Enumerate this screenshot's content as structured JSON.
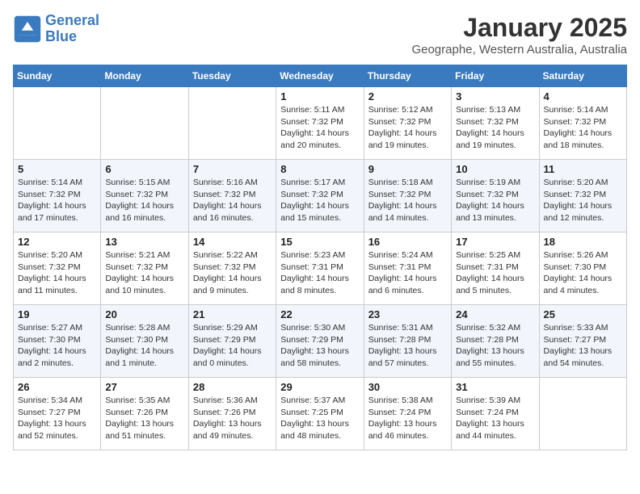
{
  "logo": {
    "line1": "General",
    "line2": "Blue"
  },
  "title": "January 2025",
  "subtitle": "Geographe, Western Australia, Australia",
  "days_of_week": [
    "Sunday",
    "Monday",
    "Tuesday",
    "Wednesday",
    "Thursday",
    "Friday",
    "Saturday"
  ],
  "weeks": [
    [
      {
        "num": "",
        "info": ""
      },
      {
        "num": "",
        "info": ""
      },
      {
        "num": "",
        "info": ""
      },
      {
        "num": "1",
        "info": "Sunrise: 5:11 AM\nSunset: 7:32 PM\nDaylight: 14 hours\nand 20 minutes."
      },
      {
        "num": "2",
        "info": "Sunrise: 5:12 AM\nSunset: 7:32 PM\nDaylight: 14 hours\nand 19 minutes."
      },
      {
        "num": "3",
        "info": "Sunrise: 5:13 AM\nSunset: 7:32 PM\nDaylight: 14 hours\nand 19 minutes."
      },
      {
        "num": "4",
        "info": "Sunrise: 5:14 AM\nSunset: 7:32 PM\nDaylight: 14 hours\nand 18 minutes."
      }
    ],
    [
      {
        "num": "5",
        "info": "Sunrise: 5:14 AM\nSunset: 7:32 PM\nDaylight: 14 hours\nand 17 minutes."
      },
      {
        "num": "6",
        "info": "Sunrise: 5:15 AM\nSunset: 7:32 PM\nDaylight: 14 hours\nand 16 minutes."
      },
      {
        "num": "7",
        "info": "Sunrise: 5:16 AM\nSunset: 7:32 PM\nDaylight: 14 hours\nand 16 minutes."
      },
      {
        "num": "8",
        "info": "Sunrise: 5:17 AM\nSunset: 7:32 PM\nDaylight: 14 hours\nand 15 minutes."
      },
      {
        "num": "9",
        "info": "Sunrise: 5:18 AM\nSunset: 7:32 PM\nDaylight: 14 hours\nand 14 minutes."
      },
      {
        "num": "10",
        "info": "Sunrise: 5:19 AM\nSunset: 7:32 PM\nDaylight: 14 hours\nand 13 minutes."
      },
      {
        "num": "11",
        "info": "Sunrise: 5:20 AM\nSunset: 7:32 PM\nDaylight: 14 hours\nand 12 minutes."
      }
    ],
    [
      {
        "num": "12",
        "info": "Sunrise: 5:20 AM\nSunset: 7:32 PM\nDaylight: 14 hours\nand 11 minutes."
      },
      {
        "num": "13",
        "info": "Sunrise: 5:21 AM\nSunset: 7:32 PM\nDaylight: 14 hours\nand 10 minutes."
      },
      {
        "num": "14",
        "info": "Sunrise: 5:22 AM\nSunset: 7:32 PM\nDaylight: 14 hours\nand 9 minutes."
      },
      {
        "num": "15",
        "info": "Sunrise: 5:23 AM\nSunset: 7:31 PM\nDaylight: 14 hours\nand 8 minutes."
      },
      {
        "num": "16",
        "info": "Sunrise: 5:24 AM\nSunset: 7:31 PM\nDaylight: 14 hours\nand 6 minutes."
      },
      {
        "num": "17",
        "info": "Sunrise: 5:25 AM\nSunset: 7:31 PM\nDaylight: 14 hours\nand 5 minutes."
      },
      {
        "num": "18",
        "info": "Sunrise: 5:26 AM\nSunset: 7:30 PM\nDaylight: 14 hours\nand 4 minutes."
      }
    ],
    [
      {
        "num": "19",
        "info": "Sunrise: 5:27 AM\nSunset: 7:30 PM\nDaylight: 14 hours\nand 2 minutes."
      },
      {
        "num": "20",
        "info": "Sunrise: 5:28 AM\nSunset: 7:30 PM\nDaylight: 14 hours\nand 1 minute."
      },
      {
        "num": "21",
        "info": "Sunrise: 5:29 AM\nSunset: 7:29 PM\nDaylight: 14 hours\nand 0 minutes."
      },
      {
        "num": "22",
        "info": "Sunrise: 5:30 AM\nSunset: 7:29 PM\nDaylight: 13 hours\nand 58 minutes."
      },
      {
        "num": "23",
        "info": "Sunrise: 5:31 AM\nSunset: 7:28 PM\nDaylight: 13 hours\nand 57 minutes."
      },
      {
        "num": "24",
        "info": "Sunrise: 5:32 AM\nSunset: 7:28 PM\nDaylight: 13 hours\nand 55 minutes."
      },
      {
        "num": "25",
        "info": "Sunrise: 5:33 AM\nSunset: 7:27 PM\nDaylight: 13 hours\nand 54 minutes."
      }
    ],
    [
      {
        "num": "26",
        "info": "Sunrise: 5:34 AM\nSunset: 7:27 PM\nDaylight: 13 hours\nand 52 minutes."
      },
      {
        "num": "27",
        "info": "Sunrise: 5:35 AM\nSunset: 7:26 PM\nDaylight: 13 hours\nand 51 minutes."
      },
      {
        "num": "28",
        "info": "Sunrise: 5:36 AM\nSunset: 7:26 PM\nDaylight: 13 hours\nand 49 minutes."
      },
      {
        "num": "29",
        "info": "Sunrise: 5:37 AM\nSunset: 7:25 PM\nDaylight: 13 hours\nand 48 minutes."
      },
      {
        "num": "30",
        "info": "Sunrise: 5:38 AM\nSunset: 7:24 PM\nDaylight: 13 hours\nand 46 minutes."
      },
      {
        "num": "31",
        "info": "Sunrise: 5:39 AM\nSunset: 7:24 PM\nDaylight: 13 hours\nand 44 minutes."
      },
      {
        "num": "",
        "info": ""
      }
    ]
  ]
}
